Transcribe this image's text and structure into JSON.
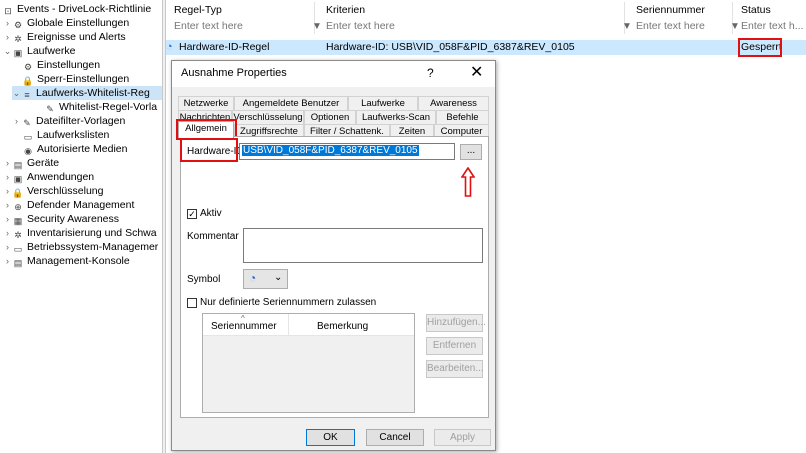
{
  "tree": {
    "items": [
      {
        "label": "Events - DriveLock-Richtlinie",
        "chev": "",
        "icon": "⊡"
      },
      {
        "label": "Globale Einstellungen",
        "chev": "›",
        "icon": "⚙"
      },
      {
        "label": "Ereignisse und Alerts",
        "chev": "›",
        "icon": "✲"
      },
      {
        "label": "Laufwerke",
        "chev": "⌄",
        "icon": "▣"
      },
      {
        "label": "Einstellungen",
        "chev": "",
        "icon": "⚙"
      },
      {
        "label": "Sperr-Einstellungen",
        "chev": "",
        "icon": "🔒"
      },
      {
        "label": "Laufwerks-Whitelist-Reg",
        "chev": "⌄",
        "icon": "≡"
      },
      {
        "label": "Whitelist-Regel-Vorla",
        "chev": "",
        "icon": "✎"
      },
      {
        "label": "Dateifilter-Vorlagen",
        "chev": "›",
        "icon": "✎"
      },
      {
        "label": "Laufwerkslisten",
        "chev": "",
        "icon": "▭"
      },
      {
        "label": "Autorisierte Medien",
        "chev": "",
        "icon": "◉"
      },
      {
        "label": "Geräte",
        "chev": "›",
        "icon": "▤"
      },
      {
        "label": "Anwendungen",
        "chev": "›",
        "icon": "▣"
      },
      {
        "label": "Verschlüsselung",
        "chev": "›",
        "icon": "🔒"
      },
      {
        "label": "Defender Management",
        "chev": "›",
        "icon": "⊕"
      },
      {
        "label": "Security Awareness",
        "chev": "›",
        "icon": "▦"
      },
      {
        "label": "Inventarisierung und Schwa",
        "chev": "›",
        "icon": "✲"
      },
      {
        "label": "Betriebssystem-Managemer",
        "chev": "›",
        "icon": "▭"
      },
      {
        "label": "Management-Konsole",
        "chev": "›",
        "icon": "▤"
      }
    ]
  },
  "grid": {
    "columns": [
      "Regel-Typ",
      "Kriterien",
      "Seriennummer",
      "Status"
    ],
    "filter_placeholders": [
      "Enter text here",
      "Enter text here",
      "Enter text here",
      "Enter text h..."
    ],
    "filter_icon": "▼",
    "row": {
      "typ": "Hardware-ID-Regel",
      "kriterien": "Hardware-ID: USB\\VID_058F&PID_6387&REV_0105",
      "seriennummer": "",
      "status": "Gesperrt"
    }
  },
  "dialog": {
    "title": "Ausnahme Properties",
    "help": "?",
    "close": "✕",
    "tabs_row1": [
      "Netzwerke",
      "Angemeldete Benutzer",
      "Laufwerke",
      "Awareness"
    ],
    "tabs_row2": [
      "Nachrichten",
      "Verschlüsselung",
      "Optionen",
      "Laufwerks-Scan",
      "Befehle"
    ],
    "tabs_row3": [
      "Allgemein",
      "Zugriffsrechte",
      "Filter / Schattenk.",
      "Zeiten",
      "Computer"
    ],
    "hardware_id_label": "Hardware-ID",
    "hardware_id_value": "USB\\VID_058F&PID_6387&REV_0105",
    "browse_button": "...",
    "aktiv_label": "Aktiv",
    "aktiv_checked": "✓",
    "kommentar_label": "Kommentar",
    "symbol_label": "Symbol",
    "symbol_dropdown_arrow": "⌄",
    "seriennummern_label": "Nur definierte Seriennummern zulassen",
    "list_columns": [
      "Seriennummer",
      "Bemerkung"
    ],
    "add_button": "Hinzufügen...",
    "remove_button": "Entfernen",
    "edit_button": "Bearbeiten...",
    "ok": "OK",
    "cancel": "Cancel",
    "apply": "Apply"
  }
}
